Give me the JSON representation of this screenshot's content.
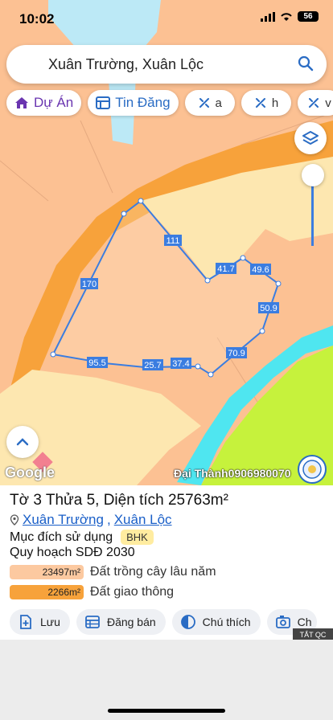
{
  "status": {
    "time": "10:02",
    "battery": "56"
  },
  "search": {
    "query": "Xuân Trường, Xuân Lộc"
  },
  "chips": [
    {
      "label": "Dự Án",
      "icon": "house-icon"
    },
    {
      "label": "Tin Đăng",
      "icon": "listing-icon"
    },
    {
      "label": "a",
      "icon": "tool-icon"
    },
    {
      "label": "h",
      "icon": "tool-icon"
    },
    {
      "label": "v",
      "icon": "tool-icon"
    }
  ],
  "map": {
    "edge_labels": [
      "170",
      "111",
      "41.7",
      "49.6",
      "50.9",
      "70.9",
      "37.4",
      "25.7",
      "95.5"
    ],
    "attribution": "Google",
    "owner": "Đại Thành0906980070"
  },
  "parcel": {
    "title": "Tờ 3 Thửa 5, Diện tích 25763m²",
    "commune": "Xuân Trường",
    "separator": ",",
    "district": "Xuân Lộc",
    "purpose_label": "Mục đích sử dụng",
    "purpose_code": "BHK",
    "plan": "Quy hoạch SDĐ 2030",
    "legend": [
      {
        "area": "23497m²",
        "label": "Đất trồng cây lâu năm",
        "color": "#fcc9a0"
      },
      {
        "area": "2266m²",
        "label": "Đất giao thông",
        "color": "#f7a23b"
      }
    ]
  },
  "actions": [
    {
      "label": "Lưu",
      "icon": "save-icon"
    },
    {
      "label": "Đăng bán",
      "icon": "post-icon"
    },
    {
      "label": "Chú thích",
      "icon": "legend-icon"
    },
    {
      "label": "Ch",
      "icon": "camera-icon"
    }
  ],
  "ad_tag": "TẮT QC"
}
